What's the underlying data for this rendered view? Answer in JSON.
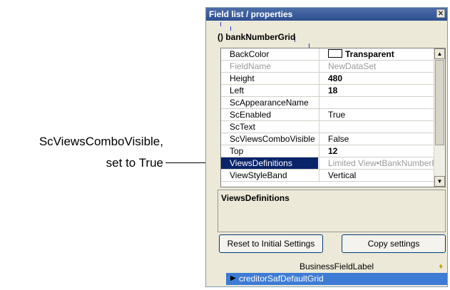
{
  "callout": {
    "line1": "ScViewsComboVisible,",
    "line2": "set to True"
  },
  "panel": {
    "title": "Field list / properties",
    "close_glyph": "✕",
    "object_name": "() bankNumberGrid",
    "properties": [
      {
        "name": "BackColor",
        "value": "Transparent",
        "style": "bold",
        "swatch": true
      },
      {
        "name": "FieldName",
        "value": "NewDataSet",
        "style": "grey"
      },
      {
        "name": "Height",
        "value": "480",
        "style": "bold"
      },
      {
        "name": "Left",
        "value": "18",
        "style": "bold"
      },
      {
        "name": "ScAppearanceName",
        "value": "",
        "style": ""
      },
      {
        "name": "ScEnabled",
        "value": "True",
        "style": ""
      },
      {
        "name": "ScText",
        "value": "",
        "style": ""
      },
      {
        "name": "ScViewsComboVisible",
        "value": "False",
        "style": ""
      },
      {
        "name": "Top",
        "value": "12",
        "style": "bold"
      },
      {
        "name": "ViewsDefinitions",
        "value": "Limited View•tBankNumberRe",
        "style": "sel"
      },
      {
        "name": "ViewStyleBand",
        "value": "Vertical",
        "style": ""
      }
    ],
    "description_title": "ViewsDefinitions",
    "buttons": {
      "reset": "Reset to Initial Settings",
      "copy": "Copy settings"
    },
    "bottom_header": "BusinessFieldLabel",
    "bottom_row": "creditorSafDefaultGrid",
    "scroll_up": "▲",
    "scroll_down": "▼",
    "row_arrow": "▶",
    "diamond": "♦"
  }
}
